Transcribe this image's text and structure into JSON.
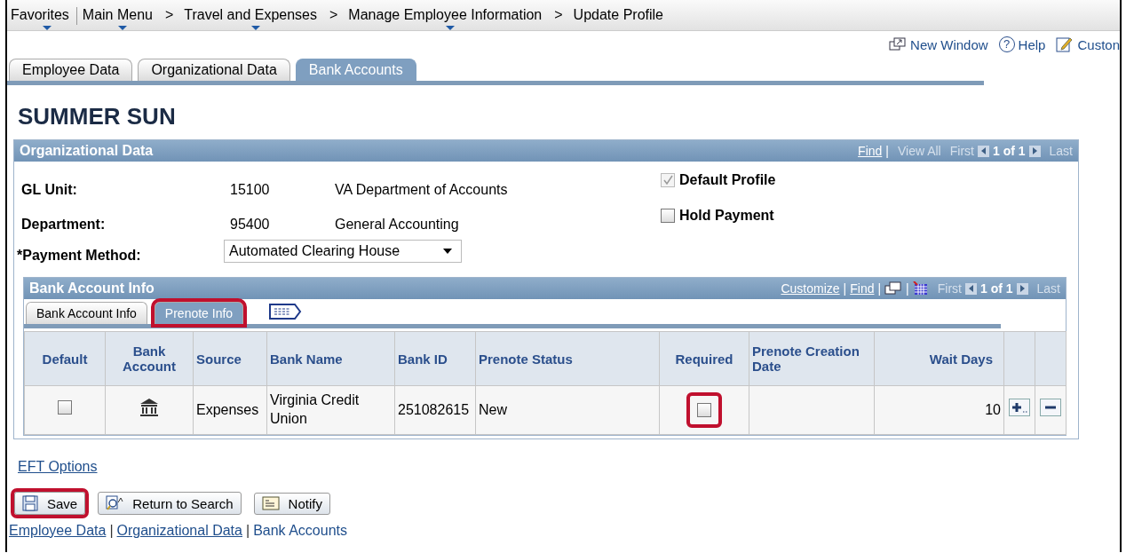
{
  "menu": [
    {
      "label": "Favorites",
      "has_menu": true,
      "kind": "item"
    },
    {
      "label": "Main Menu",
      "has_menu": true,
      "kind": "item"
    },
    {
      "label": ">",
      "kind": "sep"
    },
    {
      "label": "Travel and Expenses",
      "has_menu": true,
      "kind": "item"
    },
    {
      "label": ">",
      "kind": "sep"
    },
    {
      "label": "Manage Employee Information",
      "has_menu": true,
      "kind": "item"
    },
    {
      "label": ">",
      "kind": "sep"
    },
    {
      "label": "Update Profile",
      "has_menu": false,
      "kind": "item"
    }
  ],
  "toolbar": [
    {
      "label": "New Window",
      "kind": "window"
    },
    {
      "label": "Help",
      "kind": "help",
      "icon_text": "?"
    },
    {
      "label": "Custon",
      "kind": "customize"
    }
  ],
  "tabs": [
    {
      "label": "Employee Data",
      "selected": false
    },
    {
      "label": "Organizational Data",
      "selected": false
    },
    {
      "label": "Bank Accounts",
      "selected": true
    }
  ],
  "title": "SUMMER SUN",
  "org_panel": {
    "title": "Organizational Data",
    "nav": {
      "find": "Find",
      "pipe": "|",
      "view_all": "View All",
      "first": "First",
      "count": "1 of 1",
      "last": "Last"
    },
    "fields": [
      {
        "label": "GL Unit:",
        "code": "15100",
        "description": "VA Department of Accounts"
      },
      {
        "label": "Department:",
        "code": "95400",
        "description": "General Accounting"
      }
    ],
    "payment_method": {
      "label": "*Payment Method:",
      "value": "Automated Clearing House"
    },
    "checks": [
      {
        "label": "Default Profile",
        "checked": true,
        "disabled": true
      },
      {
        "label": "Hold Payment",
        "checked": false,
        "disabled": false
      }
    ]
  },
  "bank_grid": {
    "title": "Bank Account Info",
    "nav": {
      "customize": "Customize",
      "find": "Find",
      "pipes": [
        "|",
        "|",
        "|"
      ],
      "first": "First",
      "count": "1 of 1",
      "last": "Last"
    },
    "tabs": [
      {
        "label": "Bank Account Info",
        "selected": false,
        "highlighted": false
      },
      {
        "label": "Prenote Info",
        "selected": true,
        "highlighted": true
      }
    ],
    "columns": [
      "Default",
      "Bank Account",
      "Source",
      "Bank Name",
      "Bank ID",
      "Prenote Status",
      "Required",
      "Prenote Creation Date",
      "Wait Days"
    ],
    "rows": [
      {
        "default": false,
        "source": "Expenses",
        "bank_name": "Virginia Credit Union",
        "bank_id": "251082615",
        "prenote_status": "New",
        "required": false,
        "required_highlighted": true,
        "wait_days": "10"
      }
    ]
  },
  "eft_link": "EFT Options",
  "buttons": [
    {
      "label": "Save",
      "kind": "save",
      "highlighted": true
    },
    {
      "label": "Return to Search",
      "kind": "search",
      "highlighted": false
    },
    {
      "label": "Notify",
      "kind": "notify",
      "highlighted": false
    }
  ],
  "footer_separators": [
    "|",
    "|"
  ],
  "footer_links": [
    {
      "label": "Employee Data",
      "selected": false
    },
    {
      "label": "Organizational Data",
      "selected": false
    },
    {
      "label": "Bank Accounts",
      "selected": true
    }
  ]
}
